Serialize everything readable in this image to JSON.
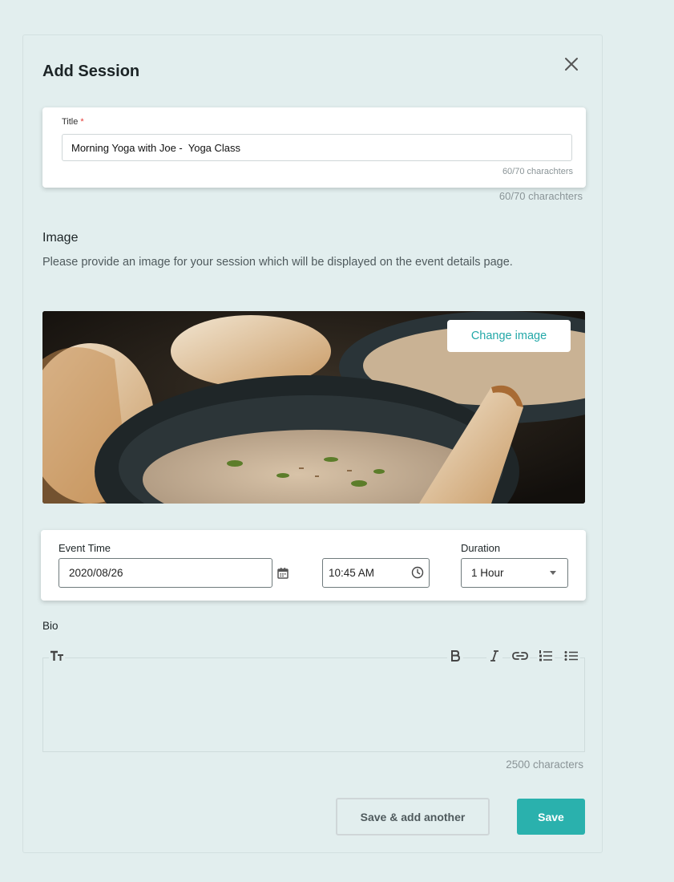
{
  "modal": {
    "title": "Add Session",
    "close_icon": "close-icon"
  },
  "title_field": {
    "label": "Title",
    "required_mark": "*",
    "value": "Morning Yoga with Joe -  Yoga Class",
    "count_inner": "60/70 charachters",
    "count_outer": "60/70 charachters"
  },
  "image": {
    "heading": "Image",
    "description": "Please provide an image for your session which will be displayed on the event details page.",
    "change_label": "Change image"
  },
  "event": {
    "time_label": "Event Time",
    "date_value": "2020/08/26",
    "time_value": "10:45 AM",
    "duration_label": "Duration",
    "duration_value": "1 Hour",
    "calendar_icon": "calendar-icon",
    "clock_icon": "clock-icon"
  },
  "bio": {
    "label": "Bio",
    "toolbar": [
      "text-size-icon",
      "bold-icon",
      "italic-icon",
      "link-icon",
      "numbered-list-icon",
      "bullet-list-icon"
    ],
    "char_count": "2500 characters"
  },
  "actions": {
    "save_another_label": "Save & add another",
    "save_label": "Save"
  },
  "colors": {
    "page_bg": "#e2eeee",
    "accent": "#2ab1ad",
    "link_accent": "#23a8a8",
    "required": "#e53935"
  }
}
